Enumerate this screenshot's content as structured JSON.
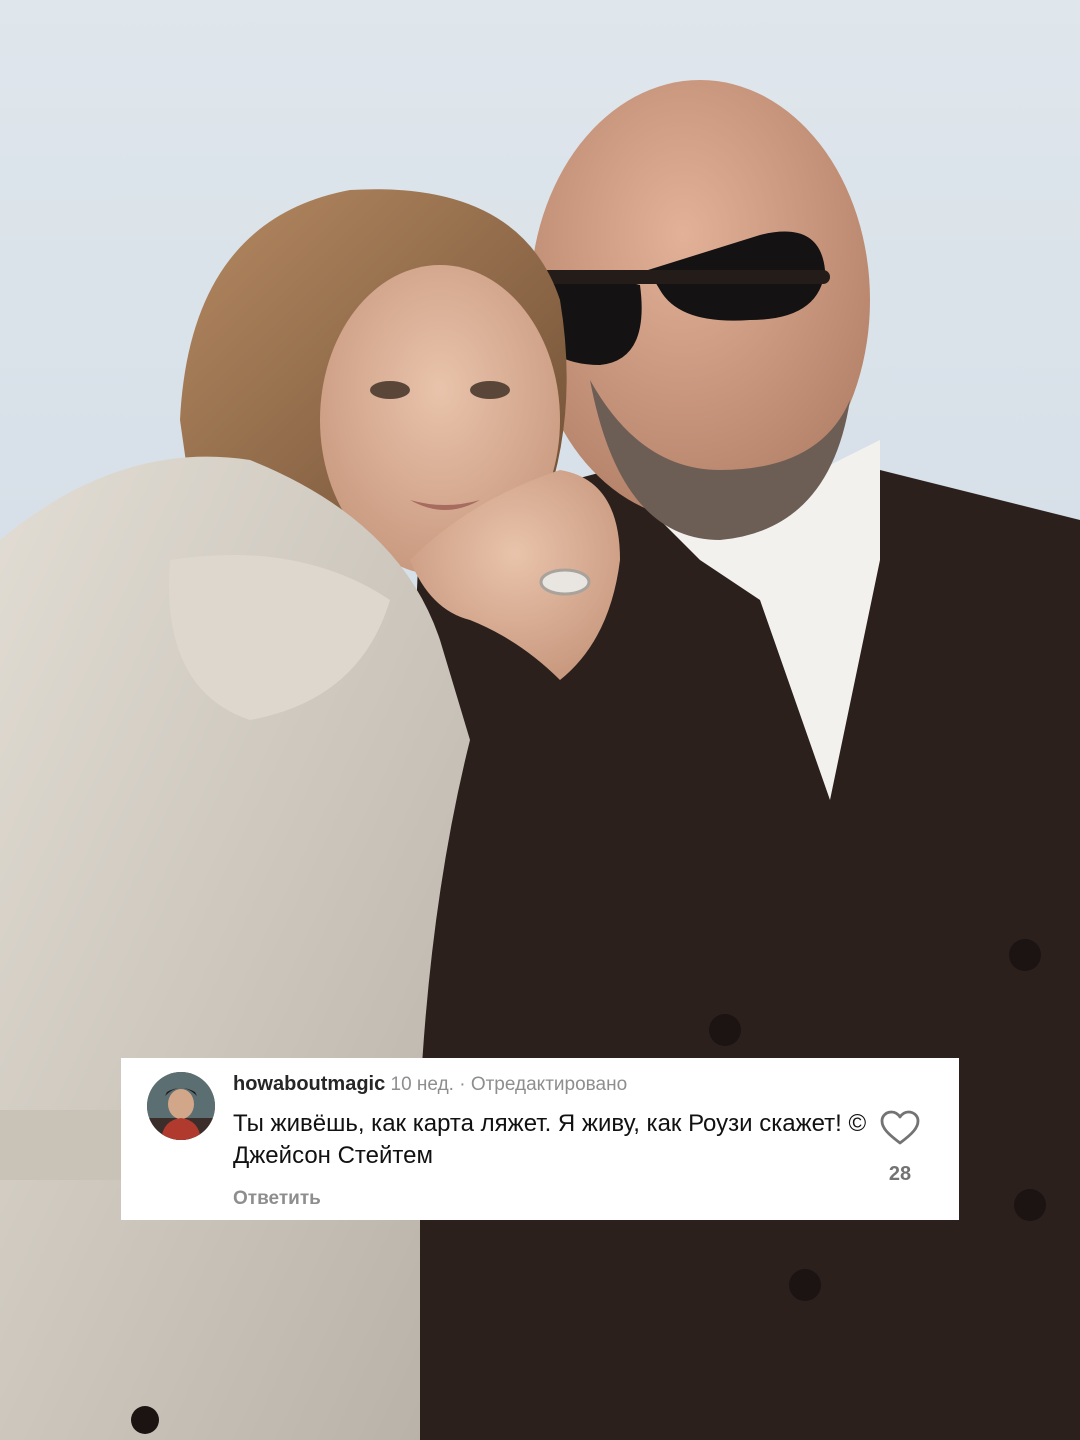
{
  "photo": {
    "description_icon": "photo-of-couple",
    "sky_color": "#dde6ee",
    "suit_color": "#2a1e1a",
    "coat_color": "#cfc8bd"
  },
  "comment": {
    "username": "howaboutmagic",
    "time": "10 нед.",
    "separator": "·",
    "edited": "Отредактировано",
    "text": "Ты живёшь, как карта ляжет. Я живу, как Роузи скажет! © Джейсон Стейтем",
    "reply_label": "Ответить",
    "like_icon": "heart-outline-icon",
    "likes": "28"
  }
}
